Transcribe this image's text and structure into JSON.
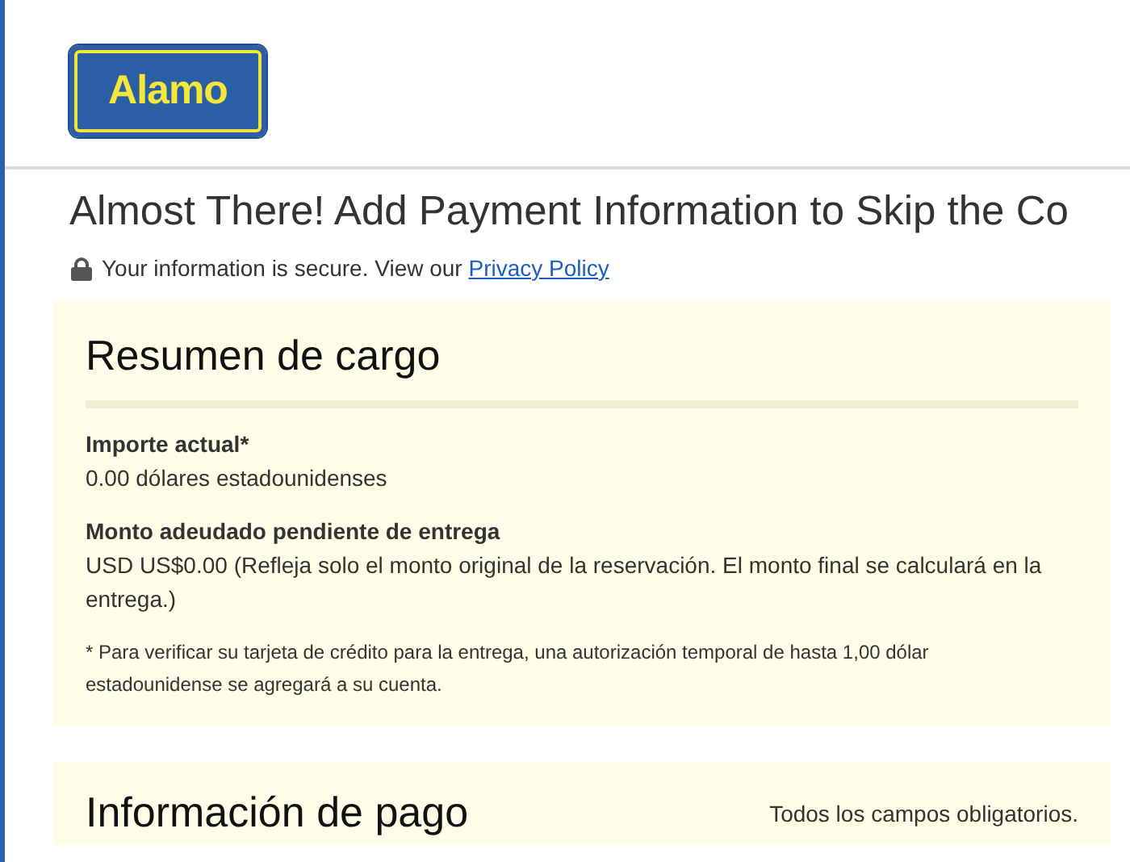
{
  "logo": {
    "text": "Alamo"
  },
  "title": "Almost There! Add Payment Information to Skip the Co",
  "security": {
    "text": "Your information is secure. View our",
    "link": "Privacy Policy"
  },
  "summary": {
    "heading": "Resumen de cargo",
    "items": [
      {
        "label": "Importe actual*",
        "value": "0.00 dólares estadounidenses"
      },
      {
        "label": "Monto adeudado pendiente de entrega",
        "value": "USD US$0.00 (Refleja solo el monto original de la reservación. El monto final se calculará en la entrega.)"
      }
    ],
    "footnote": "* Para verificar su tarjeta de crédito para la entrega, una autorización temporal de hasta 1,00 dólar estadounidense se agregará a su cuenta."
  },
  "payment": {
    "heading": "Información de pago",
    "note": "Todos los campos obligatorios."
  }
}
